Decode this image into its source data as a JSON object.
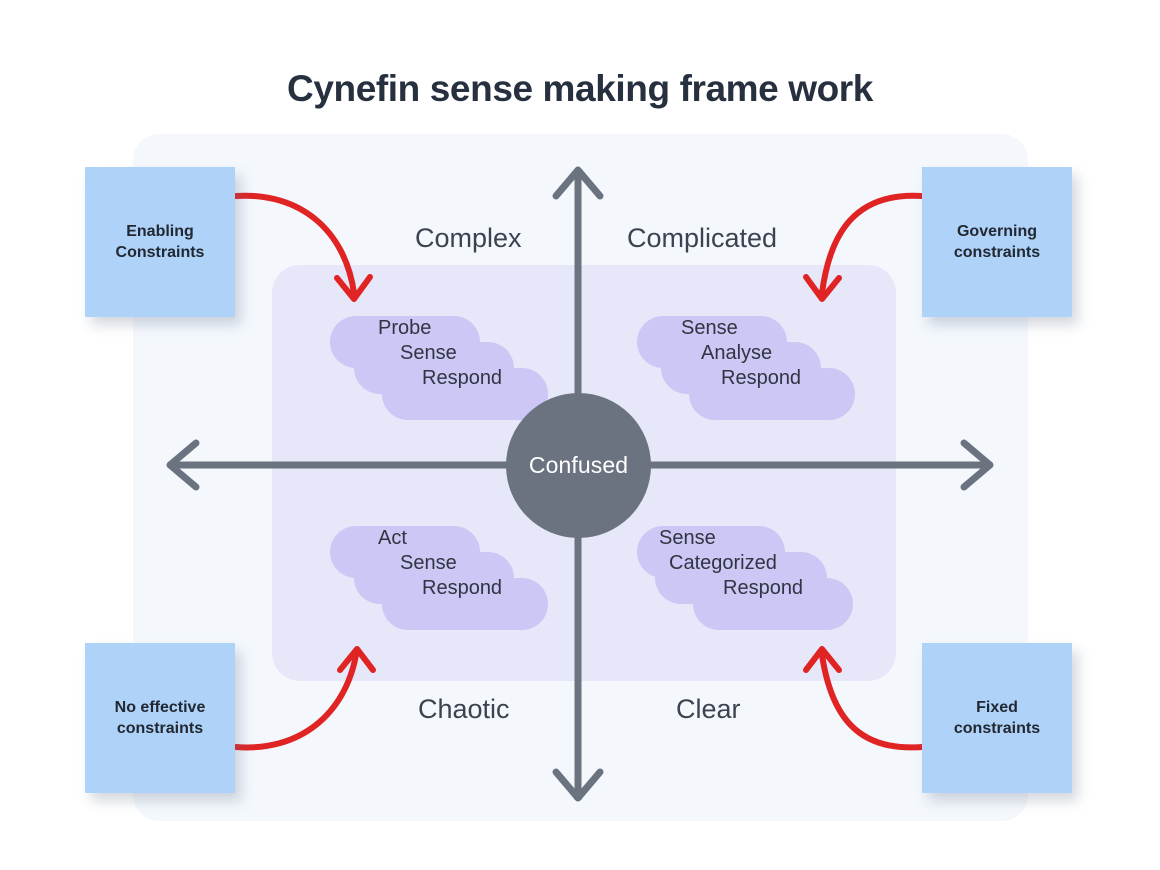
{
  "page": {
    "title": "Cynefin sense making frame work",
    "background": "#ffffff"
  },
  "colors": {
    "outer_panel": "#f4f8fd",
    "inner_panel": "#e7e7fa",
    "sticky_note": "#aed2f8",
    "cloud": "#ccc7f4",
    "axis": "#6b7280",
    "center_circle": "#6b7280",
    "arrow_red": "#e02424",
    "title_text": "#27303f",
    "quadrant_text": "#3c4350"
  },
  "center": {
    "label": "Confused"
  },
  "quadrants": [
    {
      "id": "complex",
      "label": "Complex",
      "position": "top-left",
      "practice": [
        "Probe",
        "Sense",
        "Respond"
      ]
    },
    {
      "id": "complicated",
      "label": "Complicated",
      "position": "top-right",
      "practice": [
        "Sense",
        "Analyse",
        "Respond"
      ]
    },
    {
      "id": "chaotic",
      "label": "Chaotic",
      "position": "bottom-left",
      "practice": [
        "Act",
        "Sense",
        "Respond"
      ]
    },
    {
      "id": "clear",
      "label": "Clear",
      "position": "bottom-right",
      "practice": [
        "Sense",
        "Categorized",
        "Respond"
      ]
    }
  ],
  "notes": [
    {
      "id": "enabling",
      "position": "top-left",
      "line1": "Enabling",
      "line2": "Constraints"
    },
    {
      "id": "governing",
      "position": "top-right",
      "line1": "Governing",
      "line2": "constraints"
    },
    {
      "id": "no-effective",
      "position": "bottom-left",
      "line1": "No effective",
      "line2": "constraints"
    },
    {
      "id": "fixed",
      "position": "bottom-right",
      "line1": "Fixed",
      "line2": "constraints"
    }
  ],
  "axes": {
    "vertical": "bidirectional",
    "horizontal": "bidirectional"
  }
}
